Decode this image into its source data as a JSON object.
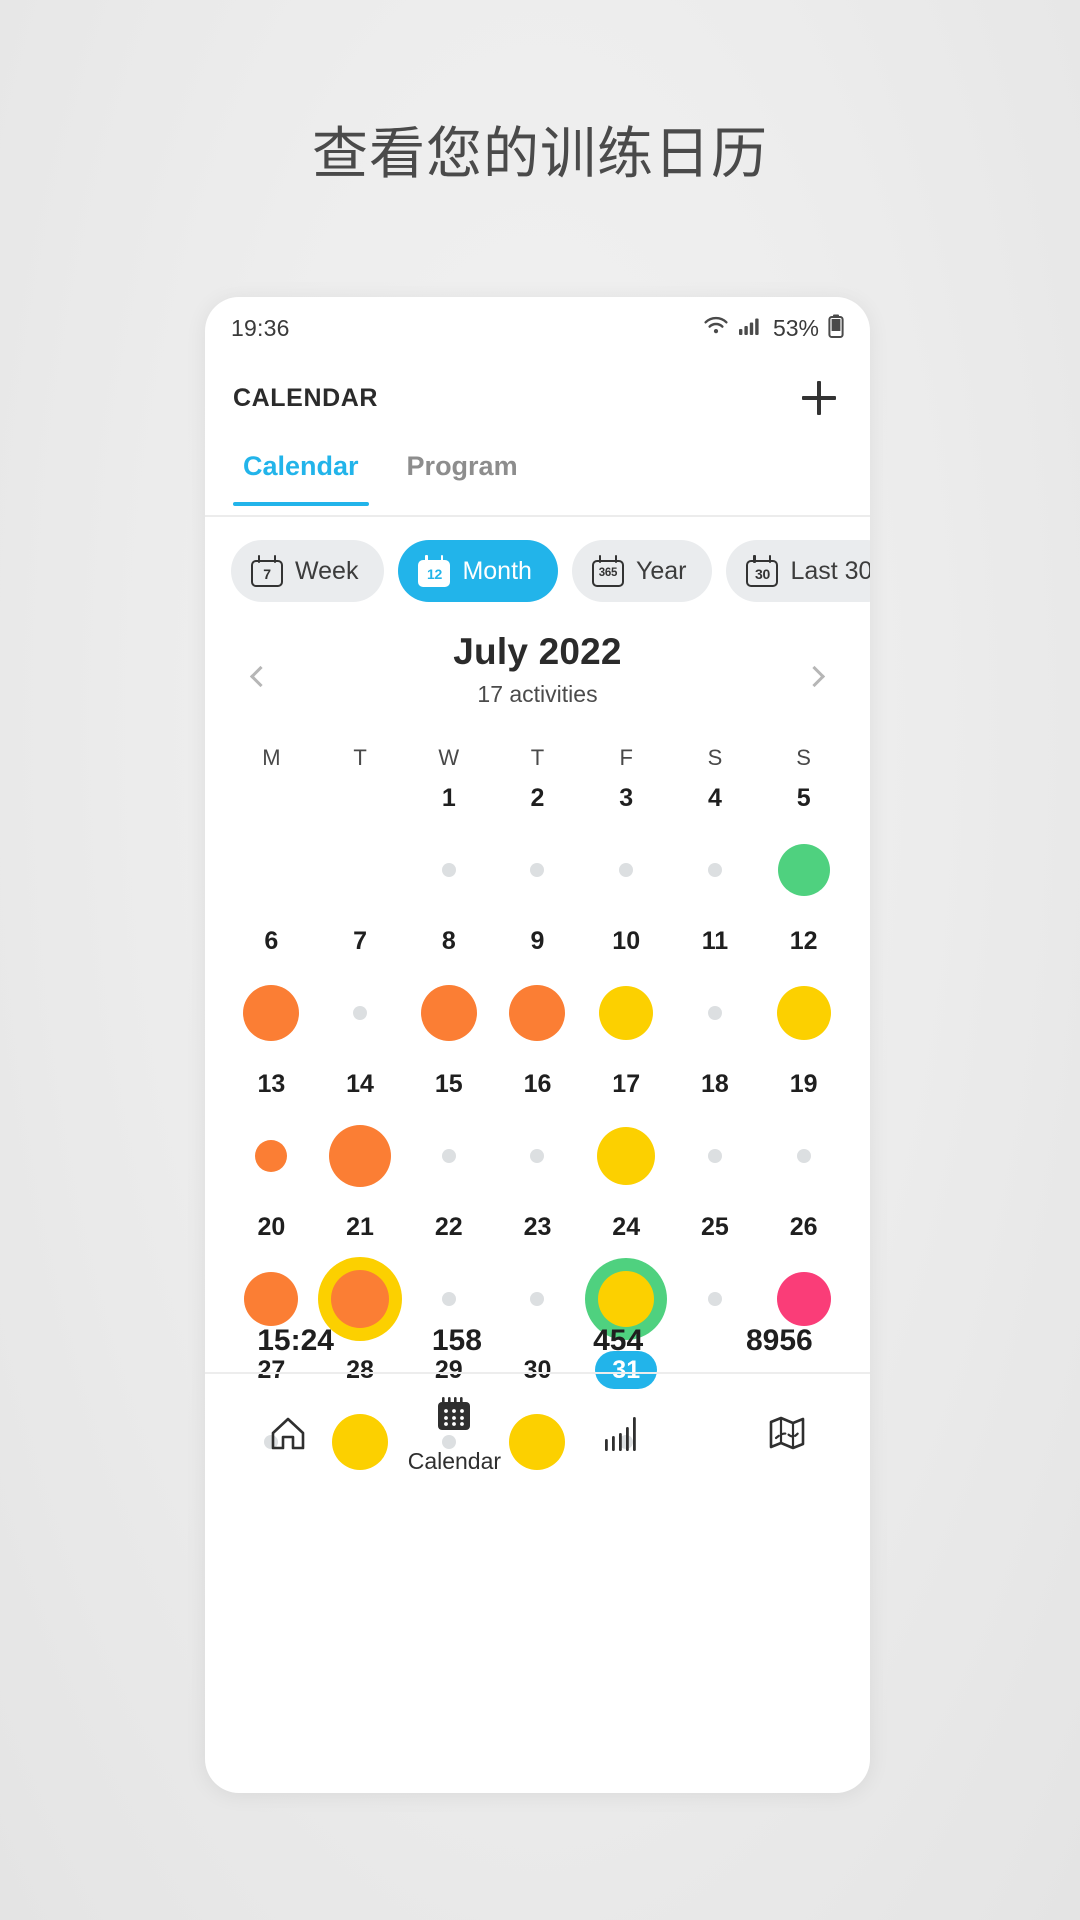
{
  "headline": "查看您的训练日历",
  "statusbar": {
    "time": "19:36",
    "battery_percent": "53%",
    "wifi_icon": "wifi-icon",
    "signal_icon": "cellular-signal-icon",
    "battery_icon": "battery-icon"
  },
  "appbar": {
    "title": "CALENDAR",
    "add_icon": "plus-icon"
  },
  "tabs": [
    {
      "label": "Calendar",
      "active": true
    },
    {
      "label": "Program",
      "active": false
    }
  ],
  "chips": [
    {
      "label": "Week",
      "icon_number": "7",
      "active": false
    },
    {
      "label": "Month",
      "icon_number": "12",
      "active": true
    },
    {
      "label": "Year",
      "icon_number": "365",
      "active": false
    },
    {
      "label": "Last 30",
      "icon_number": "30",
      "active": false
    }
  ],
  "month": {
    "title": "July 2022",
    "subtitle": "17 activities",
    "prev_icon": "chevron-left-icon",
    "next_icon": "chevron-right-icon"
  },
  "weekday_headers": [
    "M",
    "T",
    "W",
    "T",
    "F",
    "S",
    "S"
  ],
  "colors": {
    "accent": "#22b4ea",
    "orange": "#fb7e34",
    "yellow": "#fcd000",
    "green": "#4fd17f",
    "pink": "#fa3d78",
    "empty_dot": "#dcdfe1",
    "text": "#1f1f1f"
  },
  "calendar_grid": [
    [
      {
        "day": "",
        "marker": "blank"
      },
      {
        "day": "",
        "marker": "blank"
      },
      {
        "day": "1",
        "marker": "none"
      },
      {
        "day": "2",
        "marker": "none"
      },
      {
        "day": "3",
        "marker": "none"
      },
      {
        "day": "4",
        "marker": "none"
      },
      {
        "day": "5",
        "marker": "green",
        "size": 52
      }
    ],
    [
      {
        "day": "6",
        "marker": "orange",
        "size": 56
      },
      {
        "day": "7",
        "marker": "none"
      },
      {
        "day": "8",
        "marker": "orange",
        "size": 56
      },
      {
        "day": "9",
        "marker": "orange",
        "size": 56
      },
      {
        "day": "10",
        "marker": "yellow",
        "size": 54
      },
      {
        "day": "11",
        "marker": "none"
      },
      {
        "day": "12",
        "marker": "yellow",
        "size": 54
      }
    ],
    [
      {
        "day": "13",
        "marker": "orange",
        "size": 32
      },
      {
        "day": "14",
        "marker": "orange",
        "size": 62
      },
      {
        "day": "15",
        "marker": "none"
      },
      {
        "day": "16",
        "marker": "none"
      },
      {
        "day": "17",
        "marker": "yellow",
        "size": 58
      },
      {
        "day": "18",
        "marker": "none"
      },
      {
        "day": "19",
        "marker": "none"
      }
    ],
    [
      {
        "day": "20",
        "marker": "orange",
        "size": 54
      },
      {
        "day": "21",
        "marker": "ring",
        "ring_color": "yellow",
        "inner_color": "orange",
        "size": 84,
        "inner_size": 58
      },
      {
        "day": "22",
        "marker": "none"
      },
      {
        "day": "23",
        "marker": "none"
      },
      {
        "day": "24",
        "marker": "ring",
        "ring_color": "green",
        "inner_color": "yellow",
        "size": 82,
        "inner_size": 56
      },
      {
        "day": "25",
        "marker": "none"
      },
      {
        "day": "26",
        "marker": "pink",
        "size": 54
      }
    ],
    [
      {
        "day": "27",
        "marker": "none"
      },
      {
        "day": "28",
        "marker": "yellow",
        "size": 56
      },
      {
        "day": "29",
        "marker": "none"
      },
      {
        "day": "30",
        "marker": "yellow",
        "size": 56
      },
      {
        "day": "31",
        "marker": "none",
        "today": true
      },
      {
        "day": "",
        "marker": "blank"
      },
      {
        "day": "",
        "marker": "blank"
      }
    ]
  ],
  "stats": [
    "15:24",
    "158",
    "454",
    "8956"
  ],
  "bottom_nav": [
    {
      "label": "",
      "icon": "home-icon",
      "active": false
    },
    {
      "label": "Calendar",
      "icon": "calendar-icon",
      "active": true
    },
    {
      "label": "",
      "icon": "stats-bars-icon",
      "active": false
    },
    {
      "label": "",
      "icon": "map-icon",
      "active": false
    }
  ]
}
